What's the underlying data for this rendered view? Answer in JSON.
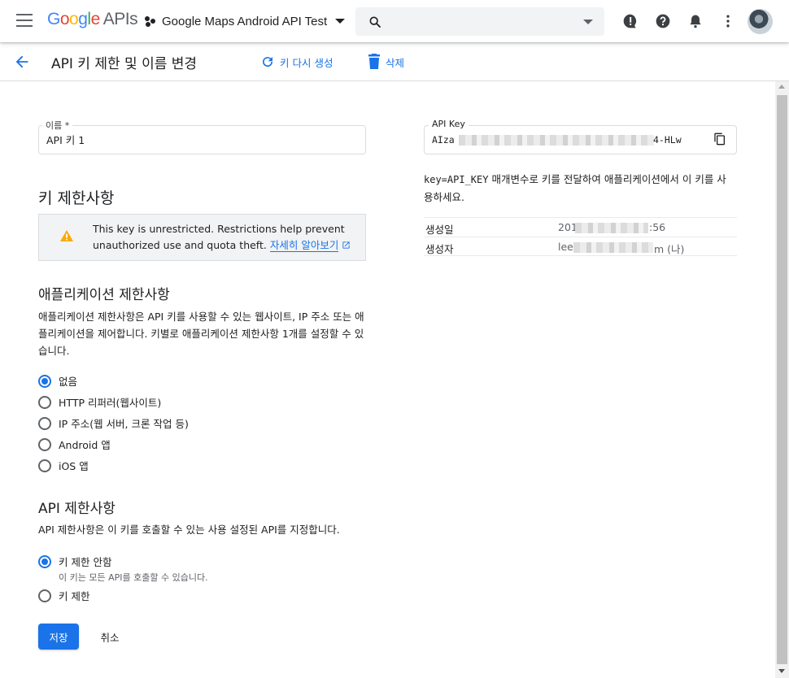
{
  "app": {
    "logo_letters": [
      "G",
      "o",
      "o",
      "g",
      "l",
      "e"
    ],
    "logo_suffix": "APIs",
    "project_name": "Google Maps Android API Test"
  },
  "header": {
    "title": "API 키 제한 및 이름 변경",
    "regenerate_label": "키 다시 생성",
    "delete_label": "삭제"
  },
  "form": {
    "name_label": "이름 *",
    "name_value": "API 키 1",
    "key_restrictions_title": "키 제한사항",
    "warning_text": "This key is unrestricted. Restrictions help prevent unauthorized use and quota theft.",
    "warning_link": "자세히 알아보기",
    "app_restrictions_title": "애플리케이션 제한사항",
    "app_restrictions_desc": "애플리케이션 제한사항은 API 키를 사용할 수 있는 웹사이트, IP 주소 또는 애플리케이션을 제어합니다. 키별로 애플리케이션 제한사항 1개를 설정할 수 있습니다.",
    "app_options": [
      {
        "label": "없음",
        "selected": true
      },
      {
        "label": "HTTP 리퍼러(웹사이트)",
        "selected": false
      },
      {
        "label": "IP 주소(웹 서버, 크론 작업 등)",
        "selected": false
      },
      {
        "label": "Android 앱",
        "selected": false
      },
      {
        "label": "iOS 앱",
        "selected": false
      }
    ],
    "api_restrictions_title": "API 제한사항",
    "api_restrictions_desc": "API 제한사항은 이 키를 호출할 수 있는 사용 설정된 API를 지정합니다.",
    "api_options": [
      {
        "label": "키 제한 안함",
        "hint": "이 키는 모든 API를 호출할 수 있습니다.",
        "selected": true
      },
      {
        "label": "키 제한",
        "hint": "",
        "selected": false
      }
    ],
    "save_label": "저장",
    "cancel_label": "취소"
  },
  "api_key": {
    "label": "API Key",
    "value_prefix": "AIza",
    "value_suffix": "4-HLw",
    "hint_code": "key=API_KEY",
    "hint_text": " 매개변수로 키를 전달하여 애플리케이션에서 이 키를 사용하세요.",
    "created_label": "생성일",
    "created_value_prefix": "201",
    "created_value_suffix": ":56",
    "creator_label": "생성자",
    "creator_value_prefix": "lee",
    "creator_value_suffix": "m (나)"
  },
  "colors": {
    "accent": "#1a73e8",
    "warning": "#f9ab00",
    "text": "#202124",
    "border": "#dadce0"
  },
  "icons": [
    "hamburger-menu-icon",
    "project-dots-icon",
    "search-icon",
    "dropdown-arrow-icon",
    "feedback-icon",
    "help-icon",
    "notifications-icon",
    "more-vert-icon",
    "back-arrow-icon",
    "refresh-icon",
    "trash-icon",
    "warning-icon",
    "external-link-icon",
    "copy-icon"
  ]
}
